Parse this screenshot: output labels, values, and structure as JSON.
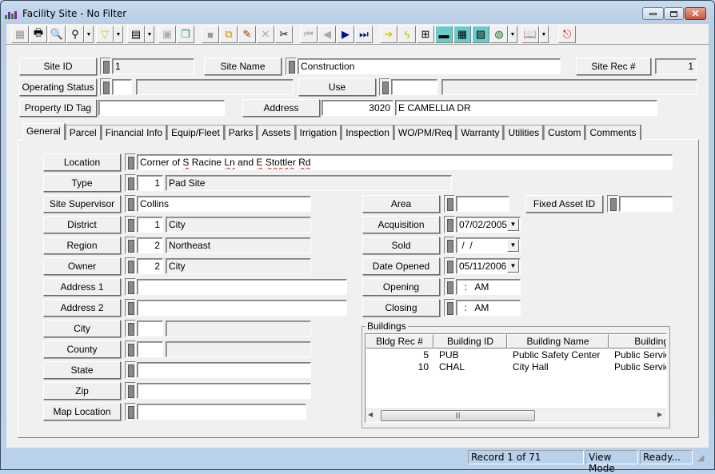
{
  "window": {
    "title": "Facility Site - No Filter"
  },
  "toolbar": {
    "buttons": [
      "screen-icon",
      "print-icon",
      "preview-icon",
      "find-icon",
      "filter-icon",
      "report-icon",
      "properties-icon",
      "copy-icon",
      "save-icon",
      "add-icon",
      "edit-icon",
      "delete-icon",
      "cut-icon",
      "first-icon",
      "prev-icon",
      "next-icon",
      "last-icon",
      "goto-icon",
      "flash-icon",
      "chart-icon",
      "equipment-icon",
      "calculator-icon",
      "map-icon",
      "globe-icon",
      "book-icon",
      "exit-icon"
    ]
  },
  "header": {
    "site_id_label": "Site ID",
    "site_id": "1",
    "site_name_label": "Site Name",
    "site_name": "Construction",
    "site_rec_label": "Site Rec #",
    "site_rec": "1",
    "operating_status_label": "Operating Status",
    "operating_status_code": "",
    "operating_status_desc": "",
    "use_label": "Use",
    "use_code": "",
    "use_desc": "",
    "property_id_label": "Property ID Tag",
    "property_id": "",
    "address_label": "Address",
    "address_number": "3020",
    "address_street": "E CAMELLIA DR"
  },
  "tabs": [
    "General",
    "Parcel",
    "Financial Info",
    "Equip/Fleet",
    "Parks",
    "Assets",
    "Irrigation",
    "Inspection",
    "WO/PM/Req",
    "Warranty",
    "Utilities",
    "Custom",
    "Comments"
  ],
  "general": {
    "location_label": "Location",
    "location": "Corner of S Racine Ln and E Stottler Rd",
    "type_label": "Type",
    "type_code": "1",
    "type_desc": "Pad Site",
    "supervisor_label": "Site Supervisor",
    "supervisor": "Collins",
    "district_label": "District",
    "district_code": "1",
    "district_desc": "City",
    "region_label": "Region",
    "region_code": "2",
    "region_desc": "Northeast",
    "owner_label": "Owner",
    "owner_code": "2",
    "owner_desc": "City",
    "address1_label": "Address 1",
    "address1": "",
    "address2_label": "Address 2",
    "address2": "",
    "city_label": "City",
    "city_code": "",
    "city_desc": "",
    "county_label": "County",
    "county_code": "",
    "county_desc": "",
    "state_label": "State",
    "state": "",
    "zip_label": "Zip",
    "zip": "",
    "map_location_label": "Map Location",
    "map_location": "",
    "area_label": "Area",
    "area": "",
    "fixed_asset_label": "Fixed Asset ID",
    "fixed_asset": "",
    "acquisition_label": "Acquisition",
    "acquisition": "07/02/2005",
    "sold_label": "Sold",
    "sold": " /  /",
    "date_opened_label": "Date Opened",
    "date_opened": "05/11/2006",
    "opening_label": "Opening",
    "opening": "  :   AM",
    "closing_label": "Closing",
    "closing": "  :   AM"
  },
  "buildings": {
    "label": "Buildings",
    "columns": [
      "Bldg Rec #",
      "Building ID",
      "Building Name",
      "Building"
    ],
    "rows": [
      {
        "rec": "5",
        "id": "PUB",
        "name": "Public Safety Center",
        "type": "Public Service"
      },
      {
        "rec": "10",
        "id": "CHAL",
        "name": "City Hall",
        "type": "Public Service"
      }
    ]
  },
  "status": {
    "record": "Record 1 of 71",
    "mode": "View Mode",
    "state": "Ready..."
  }
}
